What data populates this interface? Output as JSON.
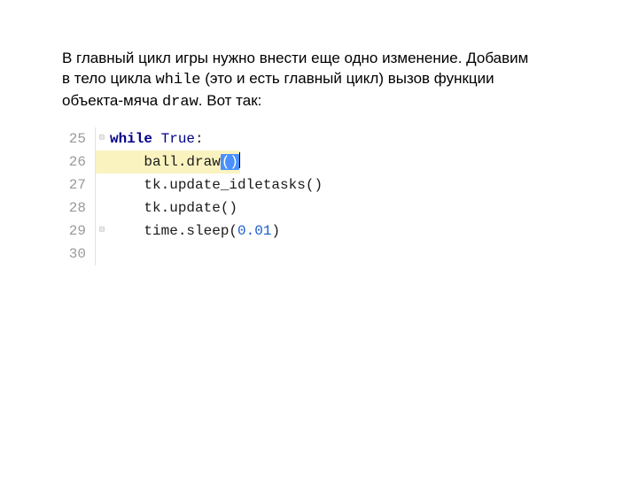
{
  "prose": {
    "line1": "В главный цикл игры нужно внести еще одно изменение. Добавим",
    "line2a": "в тело цикла ",
    "line2_code": "while",
    "line2b": "  (это и есть главный цикл) вызов функции",
    "line3a": "объекта-мяча ",
    "line3_code": "draw",
    "line3b": ". Вот так:"
  },
  "code": {
    "lines": [
      {
        "num": "25",
        "fold": "⊟",
        "hl": false,
        "tokens": [
          {
            "cls": "kw",
            "text": "while "
          },
          {
            "cls": "bkw",
            "text": "True"
          },
          {
            "cls": "plain",
            "text": ":"
          }
        ],
        "indent": ""
      },
      {
        "num": "26",
        "fold": "",
        "hl": true,
        "tokens": [
          {
            "cls": "plain",
            "text": "ball.draw"
          },
          {
            "cls": "hlspan",
            "text": "()"
          }
        ],
        "indent": "    ",
        "caret": true
      },
      {
        "num": "27",
        "fold": "",
        "hl": false,
        "tokens": [
          {
            "cls": "plain",
            "text": "tk.update_idletasks()"
          }
        ],
        "indent": "    "
      },
      {
        "num": "28",
        "fold": "",
        "hl": false,
        "tokens": [
          {
            "cls": "plain",
            "text": "tk.update()"
          }
        ],
        "indent": "    "
      },
      {
        "num": "29",
        "fold": "⊟",
        "hl": false,
        "tokens": [
          {
            "cls": "plain",
            "text": "time.sleep("
          },
          {
            "cls": "num",
            "text": "0.01"
          },
          {
            "cls": "plain",
            "text": ")"
          }
        ],
        "indent": "    "
      },
      {
        "num": "30",
        "fold": "",
        "hl": false,
        "tokens": [],
        "indent": ""
      }
    ]
  }
}
